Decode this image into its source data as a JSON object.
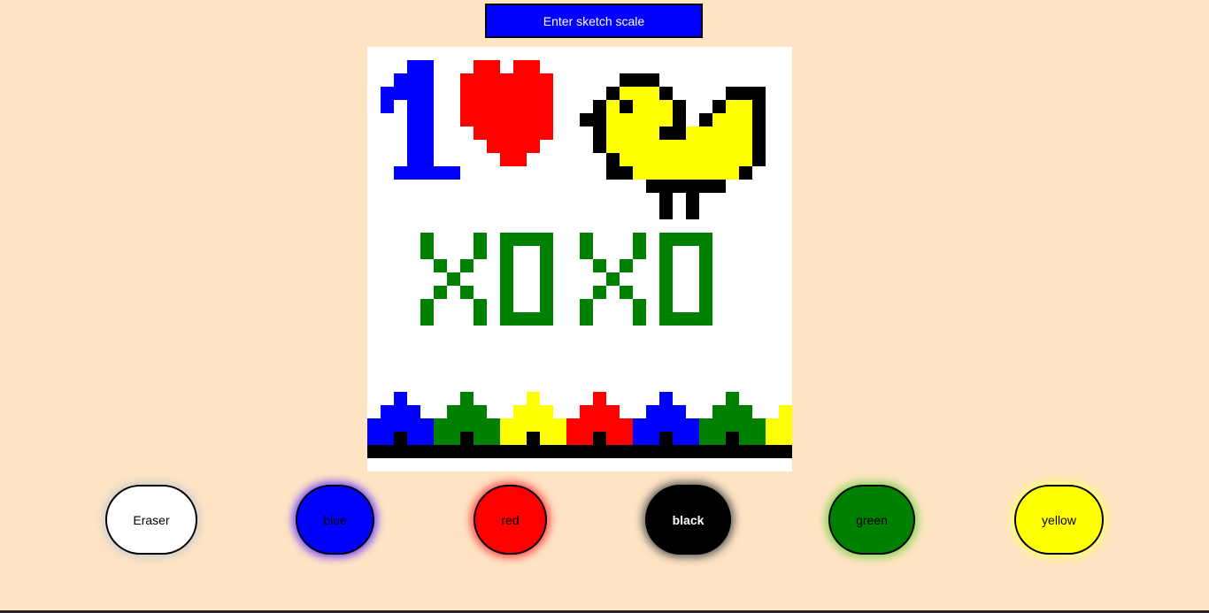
{
  "toolbar": {
    "scale_button_label": "Enter sketch scale"
  },
  "sketch": {
    "grid_columns": 32,
    "grid_rows": 32,
    "palette": {
      ".": "#ffffff",
      "B": "#0000ff",
      "R": "#ff0000",
      "K": "#000000",
      "G": "#008000",
      "Y": "#ffff00"
    },
    "pixels": [
      "................................",
      "...BB...RR.RR...................",
      "..BBB..RRRRRRR.....KKK..........",
      ".BBBB..RRRRRRR....KYYYK....KKK..",
      ".B.BB..RRRRRRR...KYKYYYK..KYYK..",
      "...BB..RRRRRRR..KKYYYYYK.KYYYK..",
      "...BB...RRRRRR...KYYYYKKYYYYYK..",
      "...BB....RRRR....KYYYYYYYYYYYK..",
      "...BB.....RR......KYYYYYYYYYYK..",
      "..BBBBB...........KKYYYYYYYYK...",
      ".....................KKKKKK.....",
      "......................K.K.......",
      "......................K.K.......",
      "................................",
      "....G...G.GGGG..G...G.GGGG......",
      "....G...G.G..G..G...G.G..G......",
      ".....G.G..G..G...G.G..G..G......",
      "......G...G..G....G...G..G......",
      ".....G.G..G..G...G.G..G..G......",
      "....G...G.G..G..G...G.G..G......",
      "....G...G.GGGG..G...G.GGGG......",
      "................................",
      "................................",
      "................................",
      "................................",
      "................................",
      "..B....G....Y....R....B....G....",
      ".BBB..GGG..YYY..RRR..BBB..GGG..Y",
      "BBBBBGGGGGYYYYYRRRRRBBBBBGGGGGYY",
      "BBKBBGGKGGYYKYYRRKRRBBKBBGGKGGYY",
      "KKKKKKKKKKKKKKKKKKKKKKKKKKKKKKKK",
      "................................"
    ]
  },
  "colors": {
    "eraser": {
      "label": "Eraser",
      "fill": "#ffffff",
      "text": "#000000",
      "glow": "#cccccc"
    },
    "blue": {
      "label": "blue",
      "fill": "#0000ff",
      "text": "#000000",
      "glow": "#6a3dff"
    },
    "red": {
      "label": "red",
      "fill": "#ff0000",
      "text": "#000000",
      "glow": "#ff4040"
    },
    "black": {
      "label": "black",
      "fill": "#000000",
      "text": "#ffffff",
      "glow": "#555555"
    },
    "green": {
      "label": "green",
      "fill": "#008000",
      "text": "#000000",
      "glow": "#7fd34f"
    },
    "yellow": {
      "label": "yellow",
      "fill": "#ffff00",
      "text": "#000000",
      "glow": "#ffff66"
    }
  }
}
